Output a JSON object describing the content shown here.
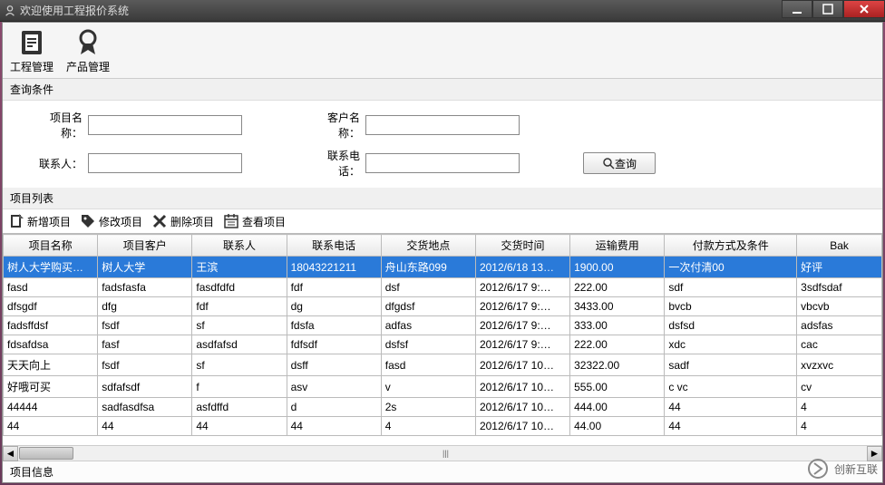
{
  "titlebar": {
    "title": "欢迎使用工程报价系统"
  },
  "toolbar": {
    "project_mgmt": "工程管理",
    "product_mgmt": "产品管理"
  },
  "sections": {
    "query_conditions": "查询条件",
    "project_list": "项目列表",
    "project_info": "项目信息"
  },
  "query": {
    "project_name_label": "项目名称：",
    "customer_name_label": "客户名称：",
    "contact_label": "联系人：",
    "phone_label": "联系电话：",
    "search_btn": "查询"
  },
  "actions": {
    "add": "新增项目",
    "edit": "修改项目",
    "delete": "删除项目",
    "view": "查看项目"
  },
  "table": {
    "headers": [
      "项目名称",
      "项目客户",
      "联系人",
      "联系电话",
      "交货地点",
      "交货时间",
      "运输费用",
      "付款方式及条件",
      "Bak"
    ],
    "rows": [
      [
        "树人大学购买…",
        "树人大学",
        "王滨",
        "18043221211",
        "舟山东路099",
        "2012/6/18 13…",
        "1900.00",
        "一次付清00",
        "好评"
      ],
      [
        "fasd",
        "fadsfasfa",
        "fasdfdfd",
        "fdf",
        "dsf",
        "2012/6/17 9:…",
        "222.00",
        "sdf",
        "3sdfsdaf"
      ],
      [
        "dfsgdf",
        "dfg",
        "fdf",
        "dg",
        "dfgdsf",
        "2012/6/17 9:…",
        "3433.00",
        "bvcb",
        "vbcvb"
      ],
      [
        "fadsffdsf",
        "fsdf",
        "sf",
        "fdsfa",
        "adfas",
        "2012/6/17 9:…",
        "333.00",
        "dsfsd",
        "adsfas"
      ],
      [
        "fdsafdsa",
        "fasf",
        "asdfafsd",
        "fdfsdf",
        "dsfsf",
        "2012/6/17 9:…",
        "222.00",
        "xdc",
        "cac"
      ],
      [
        "天天向上",
        "fsdf",
        "sf",
        "dsff",
        "fasd",
        "2012/6/17 10…",
        "32322.00",
        "sadf",
        "xvzxvc"
      ],
      [
        "好哦可买",
        "sdfafsdf",
        "f",
        "asv",
        "v",
        "2012/6/17 10…",
        "555.00",
        "c vc",
        "cv"
      ],
      [
        "44444",
        "sadfasdfsa",
        "asfdffd",
        "d",
        "2s",
        "2012/6/17 10…",
        "444.00",
        "44",
        "4"
      ],
      [
        "44",
        "44",
        "44",
        "44",
        "4",
        "2012/6/17 10…",
        "44.00",
        "44",
        "4"
      ]
    ],
    "selected_row": 0
  },
  "watermark": "创新互联"
}
